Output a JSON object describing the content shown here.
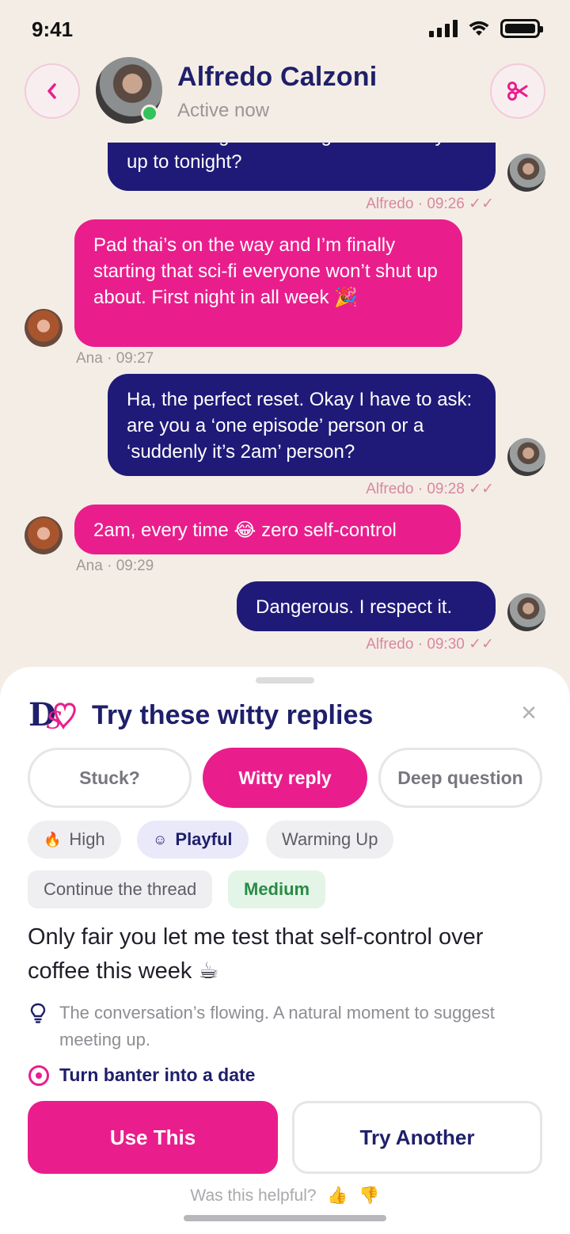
{
  "status_bar": {
    "time": "9:41"
  },
  "header": {
    "contact_name": "Alfredo Calzoni",
    "contact_status": "Active now",
    "back_icon": "chevron-left-icon",
    "action_icon": "scissors-icon"
  },
  "messages": [
    {
      "from": "Alfredo",
      "text": "Same. Long week though. What are you up to tonight?",
      "meta": "Alfredo · 09:26 ✓✓"
    },
    {
      "from": "Ana",
      "text": "Pad thai’s on the way and I’m finally starting that sci-fi everyone won’t shut up about. First night in all week 🎉",
      "meta": "Ana · 09:27"
    },
    {
      "from": "Alfredo",
      "text": "Ha, the perfect reset. Okay I have to ask: are you a ‘one episode’ person or a ‘suddenly it’s 2am’ person?",
      "meta": "Alfredo · 09:28 ✓✓"
    },
    {
      "from": "Ana",
      "text": "2am, every time 😂 zero self-control",
      "meta": "Ana · 09:29"
    },
    {
      "from": "Alfredo",
      "text": "Dangerous. I respect it.",
      "meta": "Alfredo · 09:30 ✓✓"
    }
  ],
  "sheet": {
    "title": "Try these witty replies",
    "tabs": [
      {
        "label": "Stuck?",
        "active": false
      },
      {
        "label": "Witty reply",
        "active": true
      },
      {
        "label": "Deep question",
        "active": false
      }
    ],
    "chips_row1": [
      {
        "label": "High",
        "icon": "flame-icon"
      },
      {
        "label": "Playful",
        "icon": "smile-icon"
      },
      {
        "label": "Warming Up"
      }
    ],
    "chips_row2": [
      {
        "label": "Continue the thread"
      },
      {
        "label": "Medium"
      }
    ],
    "suggestion": "Only fair you let me test that self-control over coffee this week ☕",
    "hint": "The conversation’s flowing. A natural moment to suggest meeting up.",
    "goal": "Turn banter into a date",
    "use_button": "Use This",
    "another_button": "Try Another",
    "helpful_text": "Was this helpful?",
    "thumbs_up": "👍",
    "thumbs_down": "👎"
  },
  "colors": {
    "background": "#f4ede5",
    "navy": "#1f1a78",
    "pink": "#e91e8c",
    "online": "#33c35d"
  }
}
